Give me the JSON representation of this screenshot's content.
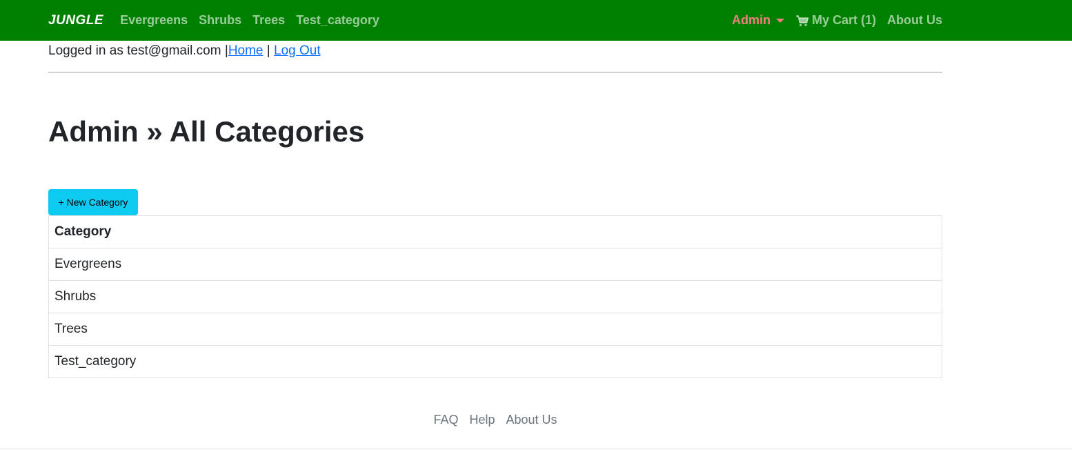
{
  "navbar": {
    "brand": "JUNGLE",
    "categories": [
      "Evergreens",
      "Shrubs",
      "Trees",
      "Test_category"
    ],
    "admin_label": "Admin",
    "cart_label": "My Cart (1)",
    "about_label": "About Us"
  },
  "login": {
    "text": "Logged in as test@gmail.com",
    "separator": "|",
    "home_label": "Home",
    "logout_label": "Log Out"
  },
  "page": {
    "title": "Admin » All Categories",
    "new_button_label": "+ New Category"
  },
  "table": {
    "header": "Category",
    "rows": [
      "Evergreens",
      "Shrubs",
      "Trees",
      "Test_category"
    ]
  },
  "footer": {
    "links": [
      "FAQ",
      "Help",
      "About Us"
    ]
  },
  "colors": {
    "navbar": "#008000",
    "admin_link": "#f08080",
    "button": "#0dcaf0",
    "link": "#0d6efd"
  }
}
